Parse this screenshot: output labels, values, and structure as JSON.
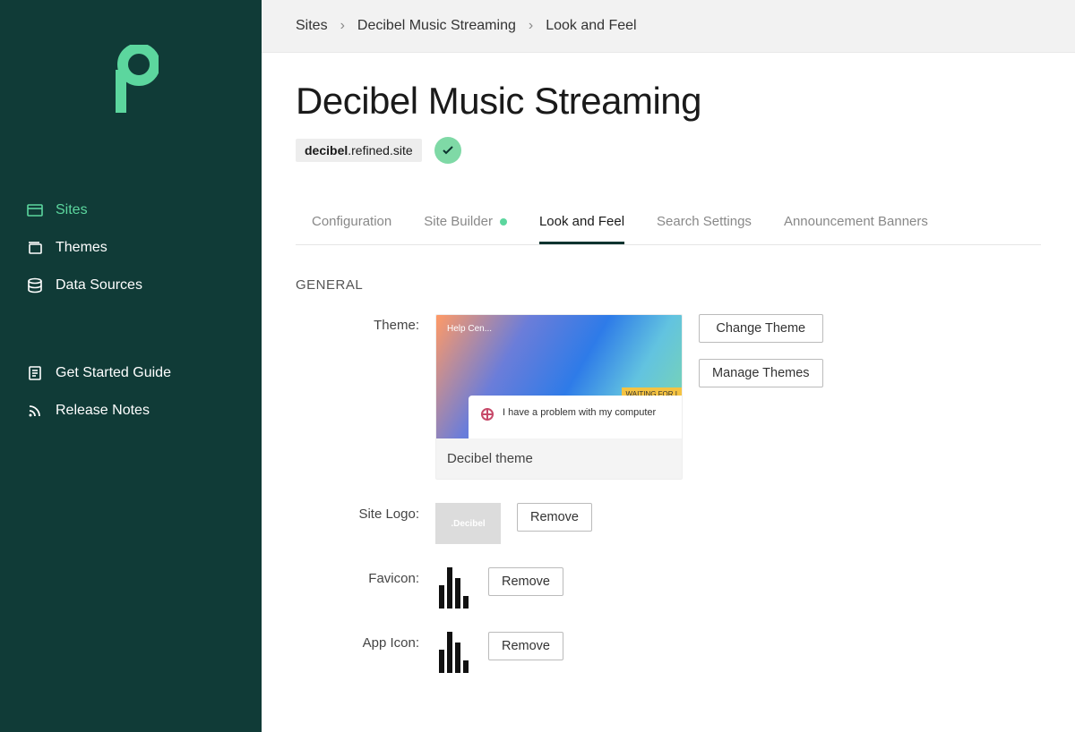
{
  "sidebar": {
    "primary": [
      {
        "label": "Sites",
        "icon": "window-icon",
        "active": true
      },
      {
        "label": "Themes",
        "icon": "stack-icon",
        "active": false
      },
      {
        "label": "Data Sources",
        "icon": "database-icon",
        "active": false
      }
    ],
    "secondary": [
      {
        "label": "Get Started Guide",
        "icon": "document-icon"
      },
      {
        "label": "Release Notes",
        "icon": "rss-icon"
      }
    ]
  },
  "breadcrumb": [
    {
      "label": "Sites"
    },
    {
      "label": "Decibel Music Streaming"
    },
    {
      "label": "Look and Feel"
    }
  ],
  "page": {
    "title": "Decibel Music Streaming",
    "subdomain_prefix": "decibel",
    "subdomain_suffix": ".refined.site"
  },
  "tabs": [
    {
      "label": "Configuration",
      "active": false,
      "dot": false
    },
    {
      "label": "Site Builder",
      "active": false,
      "dot": true
    },
    {
      "label": "Look and Feel",
      "active": true,
      "dot": false
    },
    {
      "label": "Search Settings",
      "active": false,
      "dot": false
    },
    {
      "label": "Announcement Banners",
      "active": false,
      "dot": false
    }
  ],
  "section_general": "GENERAL",
  "settings": {
    "theme": {
      "label": "Theme:",
      "hero_text": "Help Cen...",
      "panel_text": "I have a problem with my computer",
      "tag_text": "WAITING FOR I",
      "caption": "Decibel theme",
      "change_btn": "Change Theme",
      "manage_btn": "Manage Themes"
    },
    "site_logo": {
      "label": "Site Logo:",
      "preview_text": ".Decibel",
      "remove_btn": "Remove"
    },
    "favicon": {
      "label": "Favicon:",
      "remove_btn": "Remove"
    },
    "app_icon": {
      "label": "App Icon:",
      "remove_btn": "Remove"
    }
  }
}
